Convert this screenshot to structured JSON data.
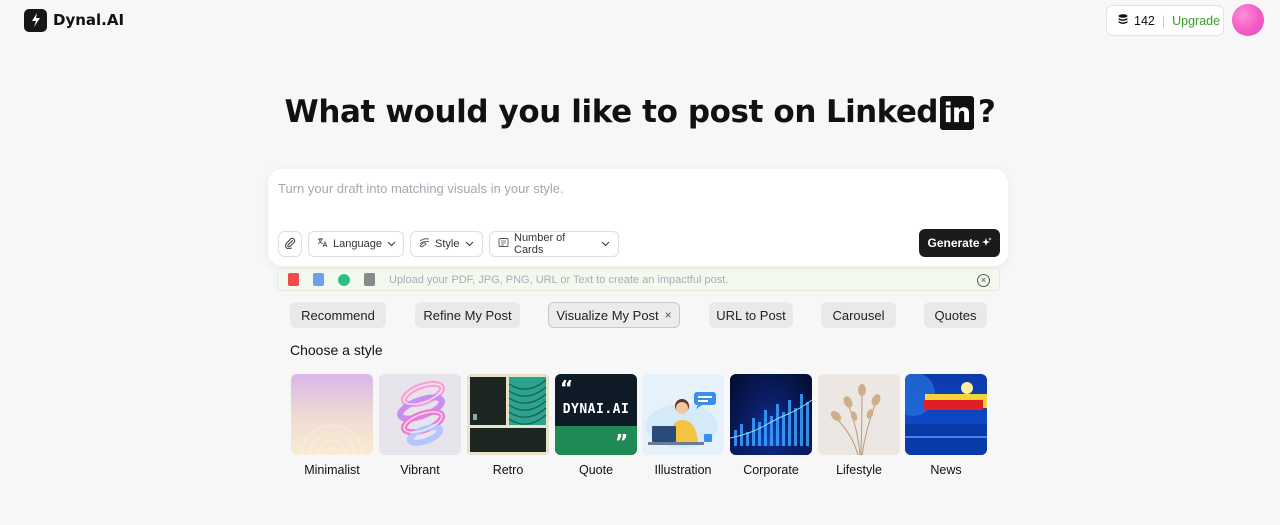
{
  "brand": {
    "name": "Dynal.AI",
    "logo": "dynal-logo-icon"
  },
  "header": {
    "credits_count": "142",
    "separator": "|",
    "upgrade_label": "Upgrade",
    "credits_icon": "coins-stack-icon",
    "avatar_color": "#f25ac5"
  },
  "headline": {
    "text": "What would you like to post on",
    "brand_word": "Linked",
    "brand_box": "in",
    "qmark": "?"
  },
  "composer": {
    "placeholder": "Turn your draft into matching visuals in your style.",
    "language_label": "Language",
    "style_label": "Style",
    "cards_label": "Number of Cards",
    "generate_label": "Generate",
    "icons": [
      "paperclip-icon",
      "translate-icon",
      "brush-icon",
      "cards-icon",
      "sparkle-icon",
      "chevron-down-icon"
    ]
  },
  "upload": {
    "hint": "Upload your PDF, JPG, PNG, URL or Text to create an impactful post.",
    "file_types": [
      "pdf-icon",
      "image-icon",
      "link-icon",
      "text-icon"
    ]
  },
  "modes": [
    {
      "label": "Recommend",
      "active": false
    },
    {
      "label": "Refine My Post",
      "active": false
    },
    {
      "label": "Visualize My Post",
      "active": true
    },
    {
      "label": "URL to Post",
      "active": false
    },
    {
      "label": "Carousel",
      "active": false
    },
    {
      "label": "Quotes",
      "active": false
    }
  ],
  "modes_close_symbol": "×",
  "styles_section": {
    "title": "Choose a style",
    "items": [
      {
        "label": "Minimalist"
      },
      {
        "label": "Vibrant"
      },
      {
        "label": "Retro"
      },
      {
        "label": "Quote",
        "thumb_text": "DYNAI.AI"
      },
      {
        "label": "Illustration"
      },
      {
        "label": "Corporate"
      },
      {
        "label": "Lifestyle"
      },
      {
        "label": "News"
      }
    ]
  },
  "colors": {
    "background": "#f7f7f7",
    "primary_button": "#1b1b1b",
    "upgrade_green": "#3a9c2a",
    "quote_green": "#1f8a54"
  }
}
